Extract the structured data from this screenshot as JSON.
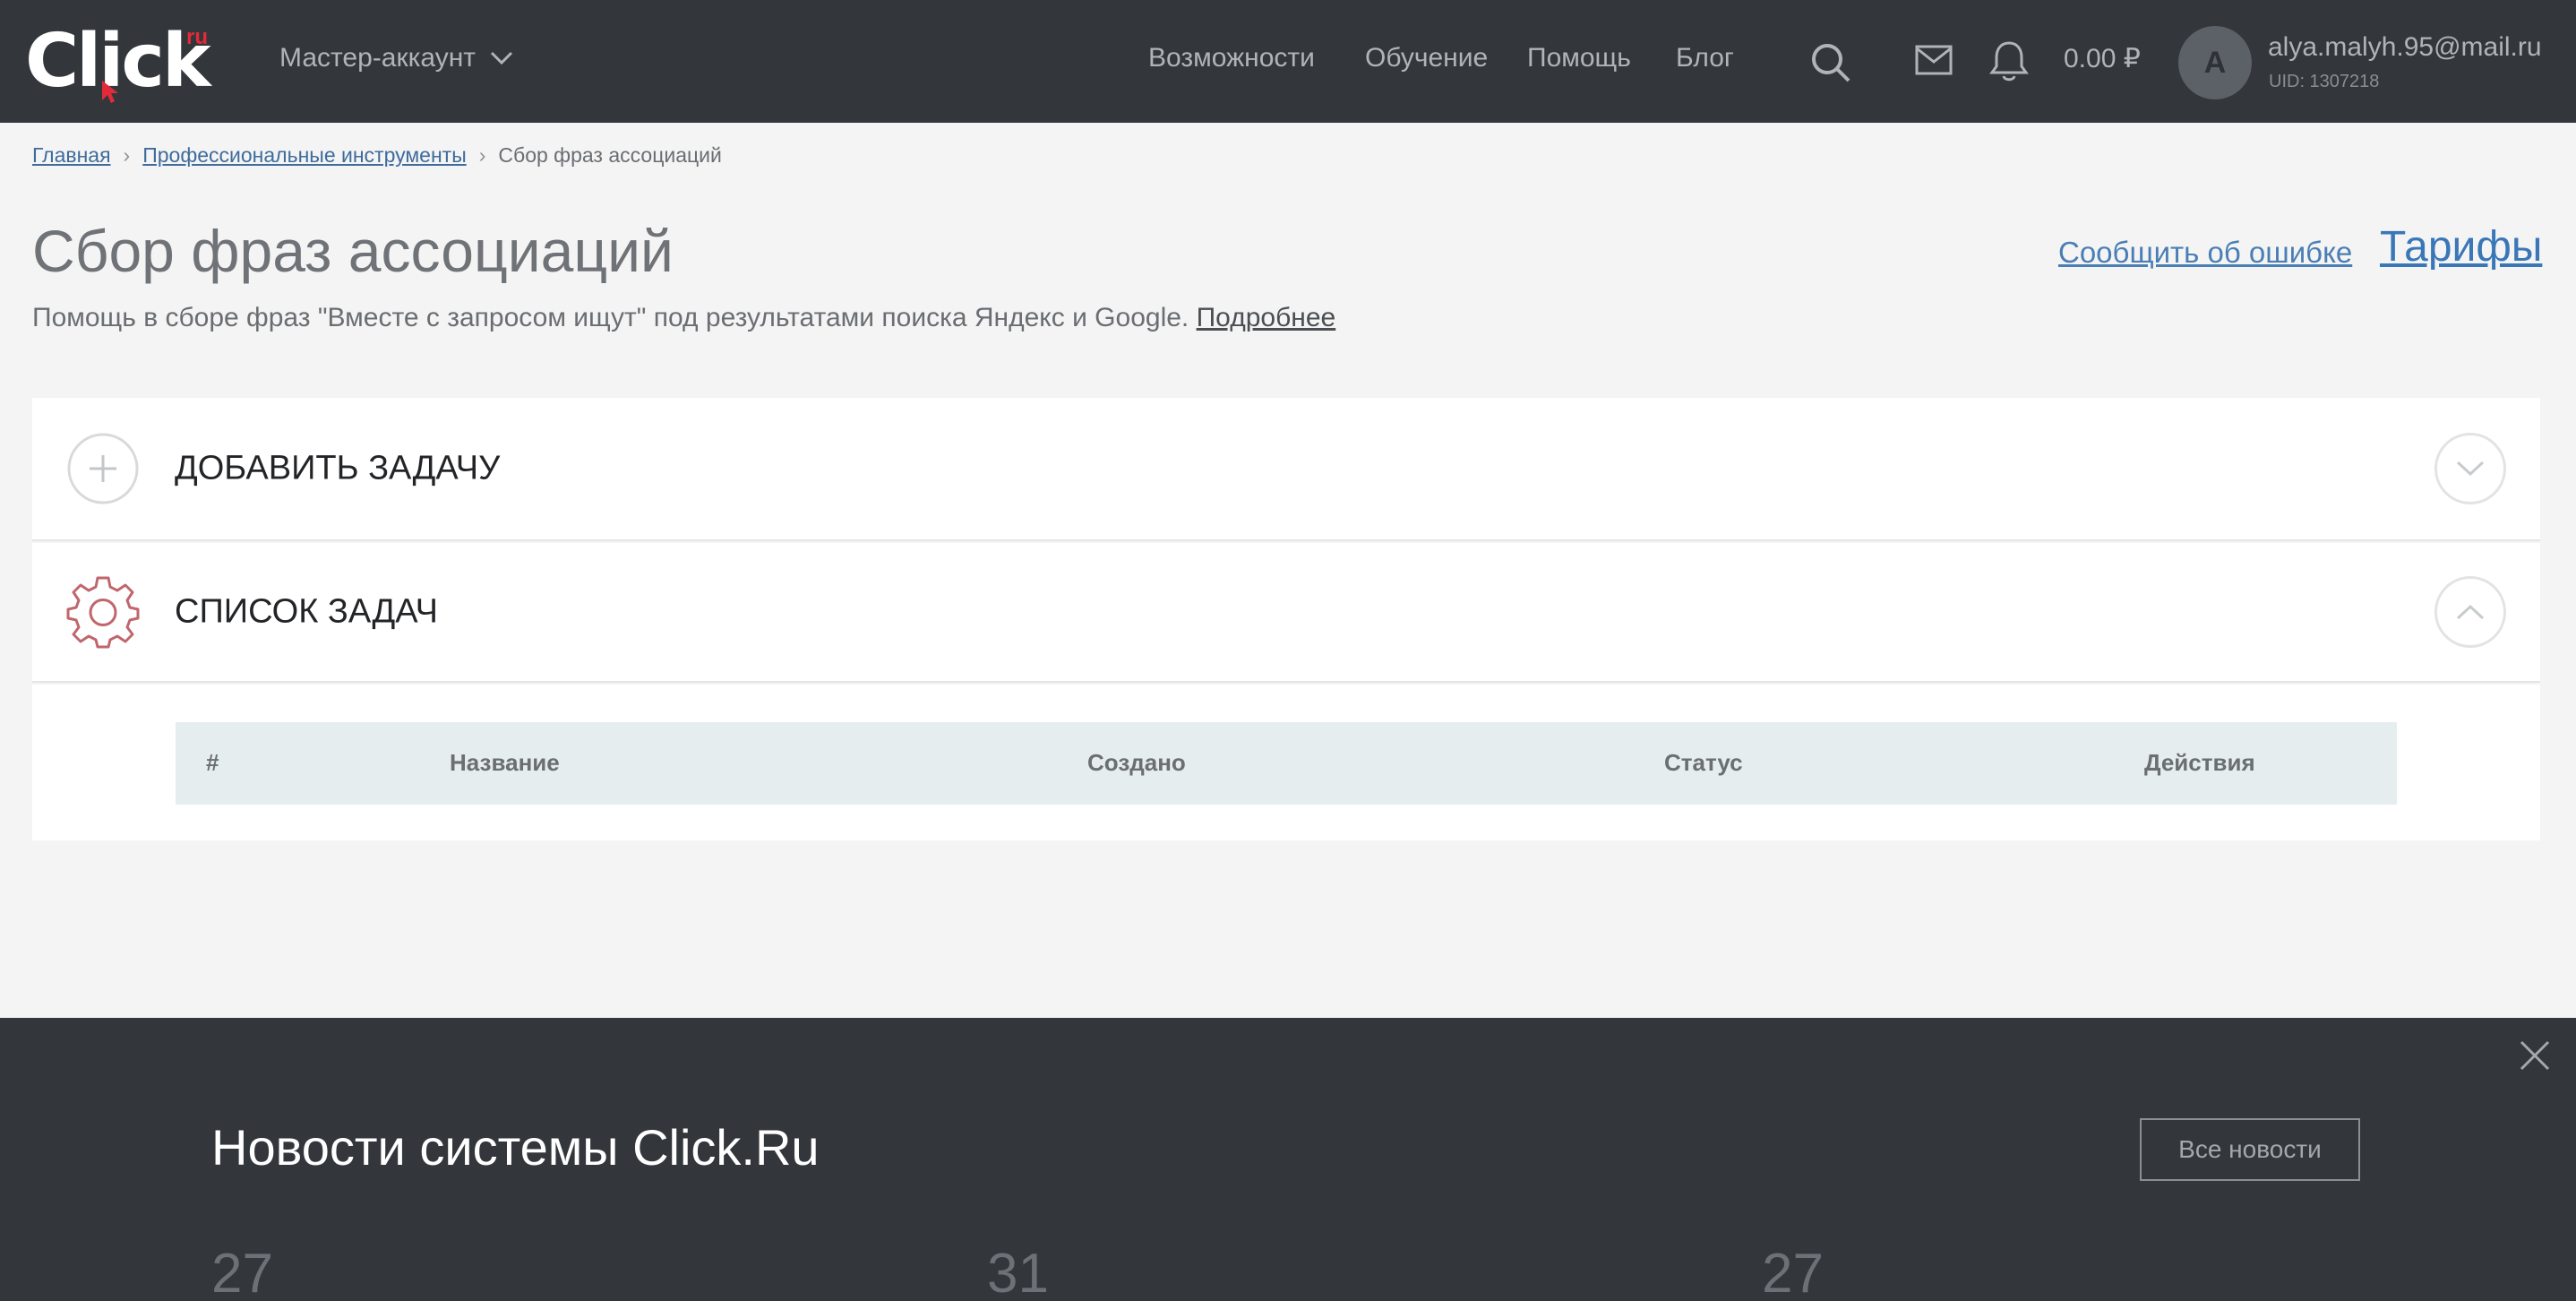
{
  "header": {
    "logo": {
      "text": "Click",
      "suffix": "ru"
    },
    "account_label": "Мастер-аккаунт",
    "nav": [
      "Возможности",
      "Обучение",
      "Помощь",
      "Блог"
    ],
    "icons": [
      "search-icon",
      "mail-icon",
      "bell-icon",
      "chevron-down-icon"
    ],
    "balance": "0.00 ₽",
    "avatar_letter": "A",
    "user_email": "alya.malyh.95@mail.ru",
    "user_uid": "UID: 1307218"
  },
  "breadcrumb": [
    "Главная",
    "Профессиональные инструменты",
    "Сбор фраз ассоциаций"
  ],
  "page": {
    "title": "Сбор фраз ассоциаций",
    "subtitle": "Помощь в сборе фраз \"Вместе с запросом ищут\" под результатами поиска Яндекс и Google.",
    "more_link": "Подробнее",
    "report_link": "Сообщить об ошибке",
    "tariffs_link": "Тарифы"
  },
  "panels": {
    "add_task": {
      "title": "ДОБАВИТЬ ЗАДАЧУ",
      "icon": "plus-circle-icon",
      "toggle_icon": "chevron-down-icon"
    },
    "task_list": {
      "title": "СПИСОК ЗАДАЧ",
      "icon": "gear-icon",
      "toggle_icon": "chevron-up-icon"
    }
  },
  "task_table": {
    "columns": [
      "#",
      "Название",
      "Создано",
      "Статус",
      "Действия"
    ]
  },
  "news": {
    "title": "Новости системы Click.Ru",
    "all_button": "Все новости",
    "dates": [
      "27",
      "31",
      "27"
    ],
    "close_icon": "close-icon"
  },
  "colors": {
    "header_bg": "#33373c",
    "page_bg": "#f4f4f4",
    "link": "#3f6c9c",
    "accent_red": "#e32a3a",
    "gear": "#c0666c",
    "table_head_bg": "#e5edef"
  }
}
